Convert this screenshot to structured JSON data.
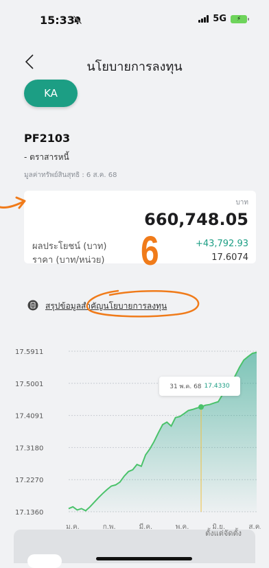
{
  "status": {
    "time": "15:33",
    "network": "5G"
  },
  "header": {
    "title": "นโยบายการลงทุน",
    "back_icon": "chevron-left-icon"
  },
  "class_button": "KA",
  "fund": {
    "code": "PF2103",
    "type": "- ตราสารหนี้",
    "nav_date": "มูลค่าทรัพย์สินสุทธิ : 6 ส.ค. 68"
  },
  "summary": {
    "currency": "บาท",
    "amount": "660,748.05",
    "profit_label": "ผลประโยชน์ (บาท)",
    "profit_value": "+43,792.93",
    "price_label": "ราคา (บาท/หน่วย)",
    "price_value": "17.6074"
  },
  "annotation": {
    "number": "6",
    "color": "#f07b1a"
  },
  "link": {
    "label": "สรุปข้อมูลสำคัญนโยบายการลงทุน"
  },
  "tooltip": {
    "date": "31 พ.ค. 68",
    "value": "17.4330"
  },
  "chart_data": {
    "type": "area",
    "x": [
      "ม.ค.",
      "ก.พ.",
      "มี.ค.",
      "พ.ค.",
      "มิ.ย.",
      "ส.ค."
    ],
    "y_ticks": [
      "17.5911",
      "17.5001",
      "17.4091",
      "17.3180",
      "17.2270",
      "17.1360"
    ],
    "ylim": [
      17.136,
      17.5911
    ],
    "series": [
      {
        "values": [
          17.145,
          17.15,
          17.141,
          17.145,
          17.139,
          17.15,
          17.163,
          17.176,
          17.188,
          17.199,
          17.209,
          17.212,
          17.22,
          17.237,
          17.25,
          17.255,
          17.27,
          17.265,
          17.297,
          17.314,
          17.335,
          17.36,
          17.383,
          17.39,
          17.379,
          17.403,
          17.406,
          17.414,
          17.423,
          17.426,
          17.43,
          17.433,
          17.438,
          17.44,
          17.444,
          17.448,
          17.468,
          17.484,
          17.5,
          17.522,
          17.546,
          17.566,
          17.576,
          17.585,
          17.588
        ]
      }
    ],
    "highlight": {
      "label": "31 พ.ค. 68",
      "value": 17.433
    },
    "colors": {
      "line": "#4ac26a",
      "fill": "#1c9e84",
      "marker_line": "#f0c040"
    }
  },
  "period": {
    "since_label": "ตั้งแต่จัดตั้ง"
  }
}
